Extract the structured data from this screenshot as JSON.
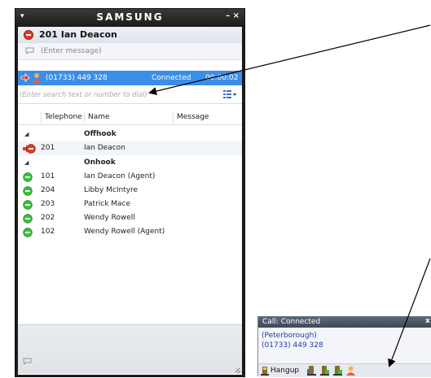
{
  "window": {
    "menu_glyph": "▾",
    "brand": "SAMSUNG",
    "controls": "– ×"
  },
  "user": {
    "name": "201 Ian Deacon",
    "status_color": "#e23b24",
    "message_placeholder": "(Enter message)"
  },
  "active_call": {
    "number": "(01733) 449 328",
    "status": "Connected",
    "timer": "00:00:02"
  },
  "search": {
    "placeholder": "(Enter search text or number to dial)"
  },
  "columns": [
    "Telephone",
    "Name",
    "Message"
  ],
  "groups": {
    "offhook": "Offhook",
    "onhook": "Onhook"
  },
  "offhook_rows": [
    {
      "telephone": "201",
      "name": "Ian Deacon",
      "status": "offhook"
    }
  ],
  "onhook_rows": [
    {
      "telephone": "101",
      "name": "Ian Deacon (Agent)",
      "status": "available"
    },
    {
      "telephone": "204",
      "name": "Libby McIntyre",
      "status": "available"
    },
    {
      "telephone": "203",
      "name": "Patrick Mace",
      "status": "available"
    },
    {
      "telephone": "202",
      "name": "Wendy Rowell",
      "status": "available"
    },
    {
      "telephone": "102",
      "name": "Wendy Rowell (Agent)",
      "status": "available"
    }
  ],
  "popup": {
    "title": "Call: Connected",
    "close": "x",
    "location": "(Peterborough)",
    "number": "(01733) 449 328",
    "hangup_label": "Hangup"
  },
  "colors": {
    "accent": "#3b8ee8",
    "available": "#3cc23c",
    "busy": "#e23b24",
    "link": "#1f3fa0"
  },
  "icons": {
    "status": "status-dot-icon",
    "message": "speech-bubble-icon",
    "incoming": "incoming-arrow-icon",
    "agent": "agent-icon",
    "view": "list-view-icon",
    "hangup": "hangup-icon"
  }
}
